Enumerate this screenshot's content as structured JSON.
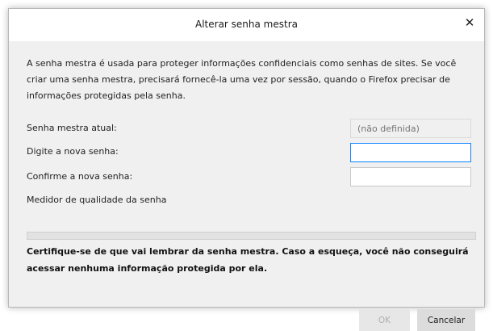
{
  "dialog": {
    "title": "Alterar senha mestra",
    "close_glyph": "✕",
    "description": "A senha mestra é usada para proteger informações confidenciais como senhas de sites. Se você criar uma senha mestra, precisará fornecê-la uma vez por sessão, quando o Firefox precisar de informações protegidas pela senha.",
    "current_password_label": "Senha mestra atual:",
    "current_password_placeholder": "(não definida)",
    "new_password_label": "Digite a nova senha:",
    "new_password_value": "",
    "confirm_password_label": "Confirme a nova senha:",
    "confirm_password_value": "",
    "meter_label": "Medidor de qualidade da senha",
    "meter_level": 0,
    "warning": "Certifique-se de que vai lembrar da senha mestra. Caso a esqueça, você não conseguirá acessar nenhuma informação protegida por ela.",
    "ok_label": "OK",
    "cancel_label": "Cancelar",
    "focus_color": "#0a84ff"
  }
}
